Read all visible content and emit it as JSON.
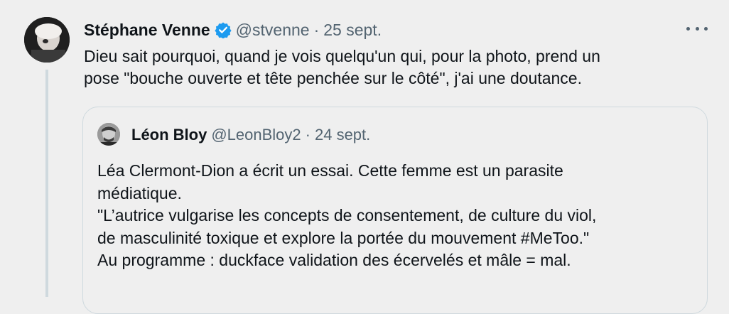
{
  "tweet": {
    "author_name": "Stéphane Venne",
    "handle": "@stvenne",
    "separator": "·",
    "date": "25 sept.",
    "verified_icon": "verified-badge-icon",
    "more_icon": "more-horizontal-icon",
    "text_lines": [
      "Dieu sait pourquoi, quand je vois quelqu'un qui, pour la photo, prend un",
      "pose \"bouche ouverte et tête penchée sur le côté\", j'ai une doutance."
    ]
  },
  "quote": {
    "author_name": "Léon Bloy",
    "handle": "@LeonBloy2",
    "separator": "·",
    "date": "24 sept.",
    "text_lines": [
      "Léa Clermont-Dion a écrit un essai. Cette femme est un parasite",
      "médiatique.",
      "\"L’autrice vulgarise les concepts de consentement, de culture du viol,",
      "de masculinité toxique et explore la portée du mouvement #MeToo.\"",
      "Au programme : duckface validation des écervelés et mâle = mal."
    ]
  },
  "colors": {
    "background": "#efefef",
    "text": "#0f1419",
    "secondary_text": "#536471",
    "verified_blue": "#1d9bf0",
    "border": "#cfd9de"
  }
}
